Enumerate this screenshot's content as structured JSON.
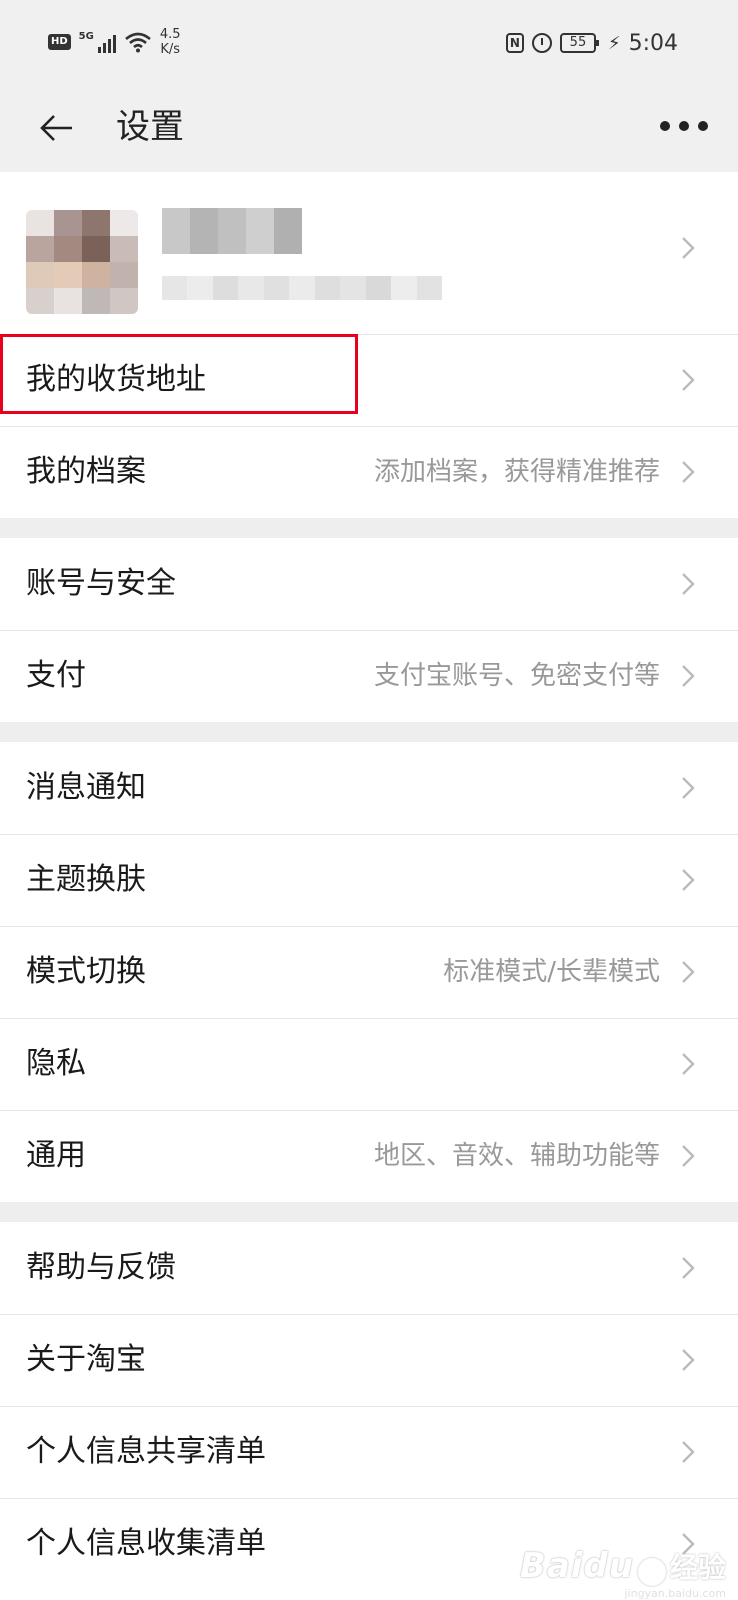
{
  "status_bar": {
    "hd": "HD",
    "network": "5G",
    "speed_value": "4.5",
    "speed_unit": "K/s",
    "nfc": "N",
    "battery": "55",
    "time": "5:04"
  },
  "header": {
    "title": "设置"
  },
  "menu": {
    "address": {
      "label": "我的收货地址",
      "value": ""
    },
    "profile_docs": {
      "label": "我的档案",
      "value": "添加档案，获得精准推荐"
    },
    "account": {
      "label": "账号与安全",
      "value": ""
    },
    "payment": {
      "label": "支付",
      "value": "支付宝账号、免密支付等"
    },
    "notifications": {
      "label": "消息通知",
      "value": ""
    },
    "theme": {
      "label": "主题换肤",
      "value": ""
    },
    "mode": {
      "label": "模式切换",
      "value": "标准模式/长辈模式"
    },
    "privacy": {
      "label": "隐私",
      "value": ""
    },
    "general": {
      "label": "通用",
      "value": "地区、音效、辅助功能等"
    },
    "help": {
      "label": "帮助与反馈",
      "value": ""
    },
    "about": {
      "label": "关于淘宝",
      "value": ""
    },
    "info_share": {
      "label": "个人信息共享清单",
      "value": ""
    },
    "info_collect": {
      "label": "个人信息收集清单",
      "value": ""
    }
  },
  "watermark": {
    "brand": "Baidu",
    "cn": "经验",
    "site": "jingyan.baidu.com"
  },
  "colors": {
    "highlight": "#e8001c",
    "header_bg": "#f0f0f0",
    "section_gap": "#eeeeee",
    "secondary_text": "#999999"
  }
}
